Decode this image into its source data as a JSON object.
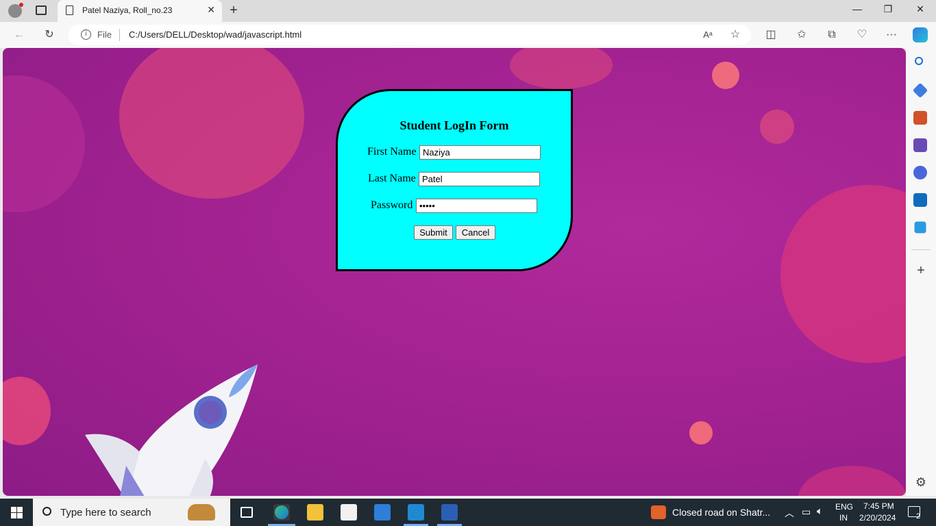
{
  "browser": {
    "tab_title": "Patel Naziya, Roll_no.23",
    "address_label": "File",
    "url": "C:/Users/DELL/Desktop/wad/javascript.html"
  },
  "form": {
    "title": "Student LogIn Form",
    "first_name_label": "First Name",
    "first_name_value": "Naziya",
    "last_name_label": "Last Name",
    "last_name_value": "Patel",
    "password_label": "Password",
    "password_value": "•••••",
    "submit_label": "Submit",
    "cancel_label": "Cancel"
  },
  "taskbar": {
    "search_placeholder": "Type here to search",
    "news": "Closed road on Shatr...",
    "lang_top": "ENG",
    "lang_bottom": "IN",
    "time": "7:45 PM",
    "date": "2/20/2024",
    "notification_count": "2"
  },
  "colors": {
    "form_background": "#00ffff",
    "page_background": "#a52392"
  }
}
